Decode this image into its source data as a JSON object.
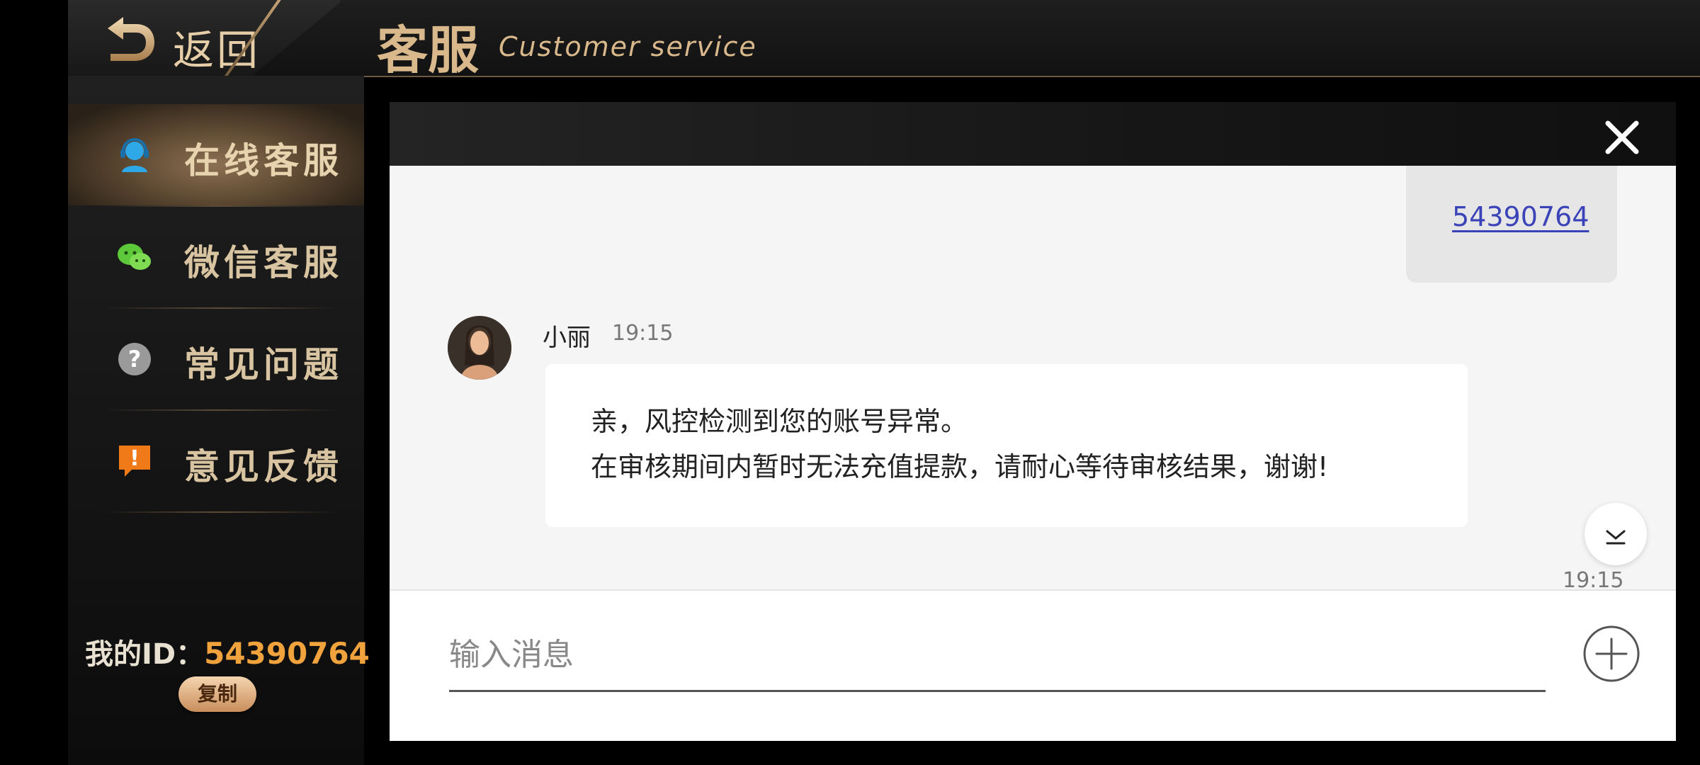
{
  "header": {
    "back_label": "返回",
    "title": "客服",
    "subtitle": "Customer service"
  },
  "sidebar": {
    "items": [
      {
        "label": "在线客服",
        "icon": "online-service-icon",
        "active": true
      },
      {
        "label": "微信客服",
        "icon": "wechat-icon",
        "active": false
      },
      {
        "label": "常见问题",
        "icon": "question-icon",
        "active": false
      },
      {
        "label": "意见反馈",
        "icon": "feedback-icon",
        "active": false
      }
    ],
    "my_id_label": "我的ID：",
    "my_id_value": "54390764",
    "copy_label": "复制"
  },
  "chat": {
    "sent_message": "54390764",
    "sender_name": "小丽",
    "sender_time": "19:15",
    "received_lines": [
      "亲，风控检测到您的账号异常。",
      "在审核期间内暂时无法充值提款，请耐心等待审核结果，谢谢!"
    ],
    "bottom_time": "19:15"
  },
  "input": {
    "placeholder": "输入消息",
    "value": ""
  },
  "colors": {
    "accent_gold": "#d9b98c",
    "id_orange": "#f0a23c",
    "link_blue": "#3b43b8"
  }
}
